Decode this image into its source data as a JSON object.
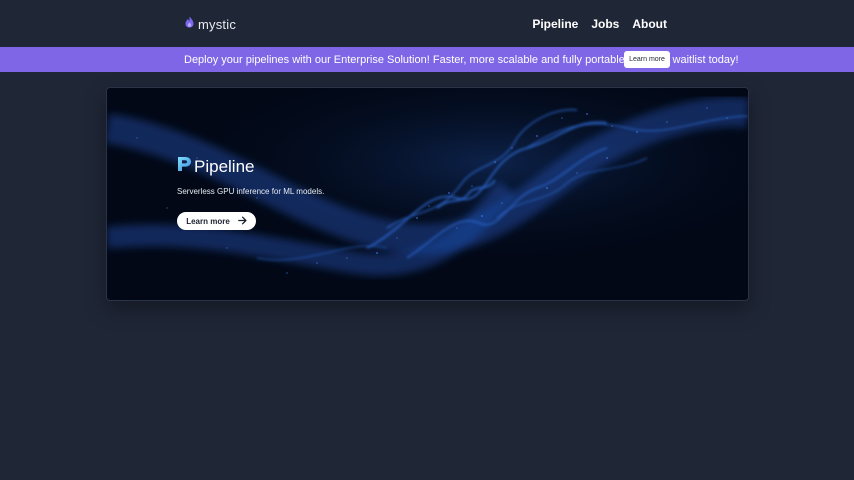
{
  "nav": {
    "brand": "mystic",
    "links": [
      "Pipeline",
      "Jobs",
      "About"
    ]
  },
  "banner": {
    "message": "Deploy your pipelines with our Enterprise Solution! Faster, more scalable and fully portable. Join the waitlist today!",
    "button_label": "Learn more"
  },
  "hero": {
    "product_name": "Pipeline",
    "tagline": "Serverless GPU inference for ML models.",
    "cta_label": "Learn more"
  },
  "colors": {
    "page_bg": "#1f2636",
    "banner_bg": "#7f66e6",
    "hero_bg": "#020816",
    "accent_blue": "#2f6fe0"
  },
  "icons": {
    "brand": "flame-drop-icon",
    "product": "pipeline-p-icon",
    "cta": "arrow-right-icon"
  }
}
